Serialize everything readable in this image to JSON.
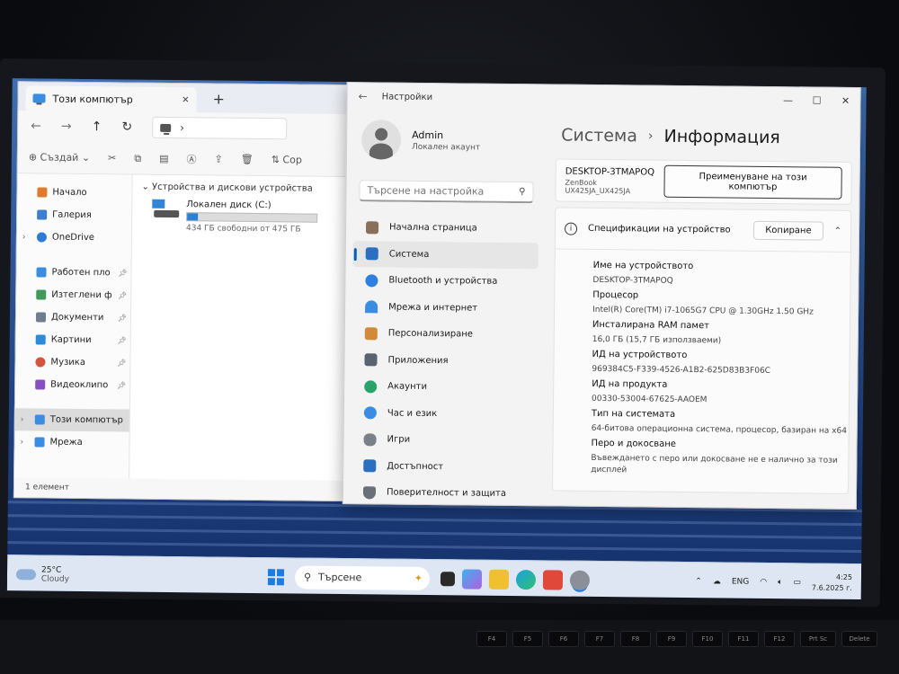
{
  "explorer": {
    "tab_title": "Този компютър",
    "new_tab": "+",
    "close": "✕",
    "nav": {
      "back": "←",
      "forward": "→",
      "up": "↑",
      "refresh": "↻",
      "addr_chevron": "›"
    },
    "cmd": {
      "new": "Създай",
      "sort": "Сор"
    },
    "sidebar": [
      {
        "label": "Начало",
        "color": "#e07a2e",
        "pin": false,
        "chev": false
      },
      {
        "label": "Галерия",
        "color": "#3a7fd0",
        "pin": false,
        "chev": false
      },
      {
        "label": "OneDrive",
        "color": "#2b7bd6",
        "pin": false,
        "chev": true
      },
      {
        "label": "Работен пло",
        "color": "#3a8de0",
        "pin": true,
        "chev": false
      },
      {
        "label": "Изтеглени ф",
        "color": "#3f9a5c",
        "pin": true,
        "chev": false
      },
      {
        "label": "Документи",
        "color": "#6e7e8f",
        "pin": true,
        "chev": false
      },
      {
        "label": "Картини",
        "color": "#2e8bd6",
        "pin": true,
        "chev": false
      },
      {
        "label": "Музика",
        "color": "#d3553b",
        "pin": true,
        "chev": false
      },
      {
        "label": "Видеоклипо",
        "color": "#8a4ec0",
        "pin": true,
        "chev": false
      },
      {
        "label": "Този компютър",
        "color": "#3a8de0",
        "pin": false,
        "chev": true
      },
      {
        "label": "Мрежа",
        "color": "#3a8de0",
        "pin": false,
        "chev": true
      }
    ],
    "group_header": "Устройства и дискови устройства",
    "drive": {
      "name": "Локален диск (C:)",
      "free_text": "434 ГБ свободни от 475 ГБ",
      "used_fraction": 0.086
    },
    "status": "1 елемент"
  },
  "settings": {
    "title": "Настройки",
    "account": {
      "name": "Admin",
      "type": "Локален акаунт"
    },
    "search_placeholder": "Търсене на настройка",
    "nav": [
      {
        "label": "Начална страница",
        "icon": "home-icon",
        "color": "#8a6f5a"
      },
      {
        "label": "Система",
        "icon": "system-icon",
        "color": "#2a6fc0"
      },
      {
        "label": "Bluetooth и устройства",
        "icon": "bluetooth-icon",
        "color": "#2d7fe0"
      },
      {
        "label": "Мрежа и интернет",
        "icon": "wifi-icon",
        "color": "#3a8de0"
      },
      {
        "label": "Персонализиране",
        "icon": "brush-icon",
        "color": "#d08a3a"
      },
      {
        "label": "Приложения",
        "icon": "apps-icon",
        "color": "#5a6470"
      },
      {
        "label": "Акаунти",
        "icon": "person-icon",
        "color": "#2aa36a"
      },
      {
        "label": "Час и език",
        "icon": "clock-globe-icon",
        "color": "#3a8de0"
      },
      {
        "label": "Игри",
        "icon": "gamepad-icon",
        "color": "#7a8088"
      },
      {
        "label": "Достъпност",
        "icon": "accessibility-icon",
        "color": "#2a6fc0"
      },
      {
        "label": "Поверителност и защита",
        "icon": "shield-icon",
        "color": "#6a7078"
      }
    ],
    "breadcrumb": {
      "parent": "Система",
      "current": "Информация"
    },
    "device": {
      "name": "DESKTOP-3TMAPOQ",
      "model": "ZenBook UX425JA_UX425JA",
      "rename_label": "Преименуване на този компютър"
    },
    "specs": {
      "title": "Спецификации на устройство",
      "copy_label": "Копиране",
      "items": [
        {
          "label": "Име на устройството",
          "value": "DESKTOP-3TMAPOQ"
        },
        {
          "label": "Процесор",
          "value": "Intel(R) Core(TM) i7-1065G7 CPU @ 1.30GHz   1.50 GHz"
        },
        {
          "label": "Инсталирана RAM памет",
          "value": "16,0 ГБ (15,7 ГБ използваеми)"
        },
        {
          "label": "ИД на устройството",
          "value": "969384C5-F339-4526-A1B2-625D83B3F06C"
        },
        {
          "label": "ИД на продукта",
          "value": "00330-53004-67625-AAOEM"
        },
        {
          "label": "Тип на системата",
          "value": "64-битова операционна система, процесор, базиран на x64"
        },
        {
          "label": "Перо и докосване",
          "value": "Въвеждането с перо или докосване не е налично за този дисплей"
        }
      ]
    }
  },
  "taskbar": {
    "weather_temp": "25°C",
    "weather_cond": "Cloudy",
    "search_label": "Търсене",
    "lang": "ENG",
    "time": "4:25",
    "date": "7.6.2025 г."
  },
  "keyboard": [
    "F4",
    "F5",
    "F6",
    "F7",
    "F8",
    "F9",
    "F10",
    "F11",
    "F12",
    "Prt Sc",
    "Delete"
  ]
}
